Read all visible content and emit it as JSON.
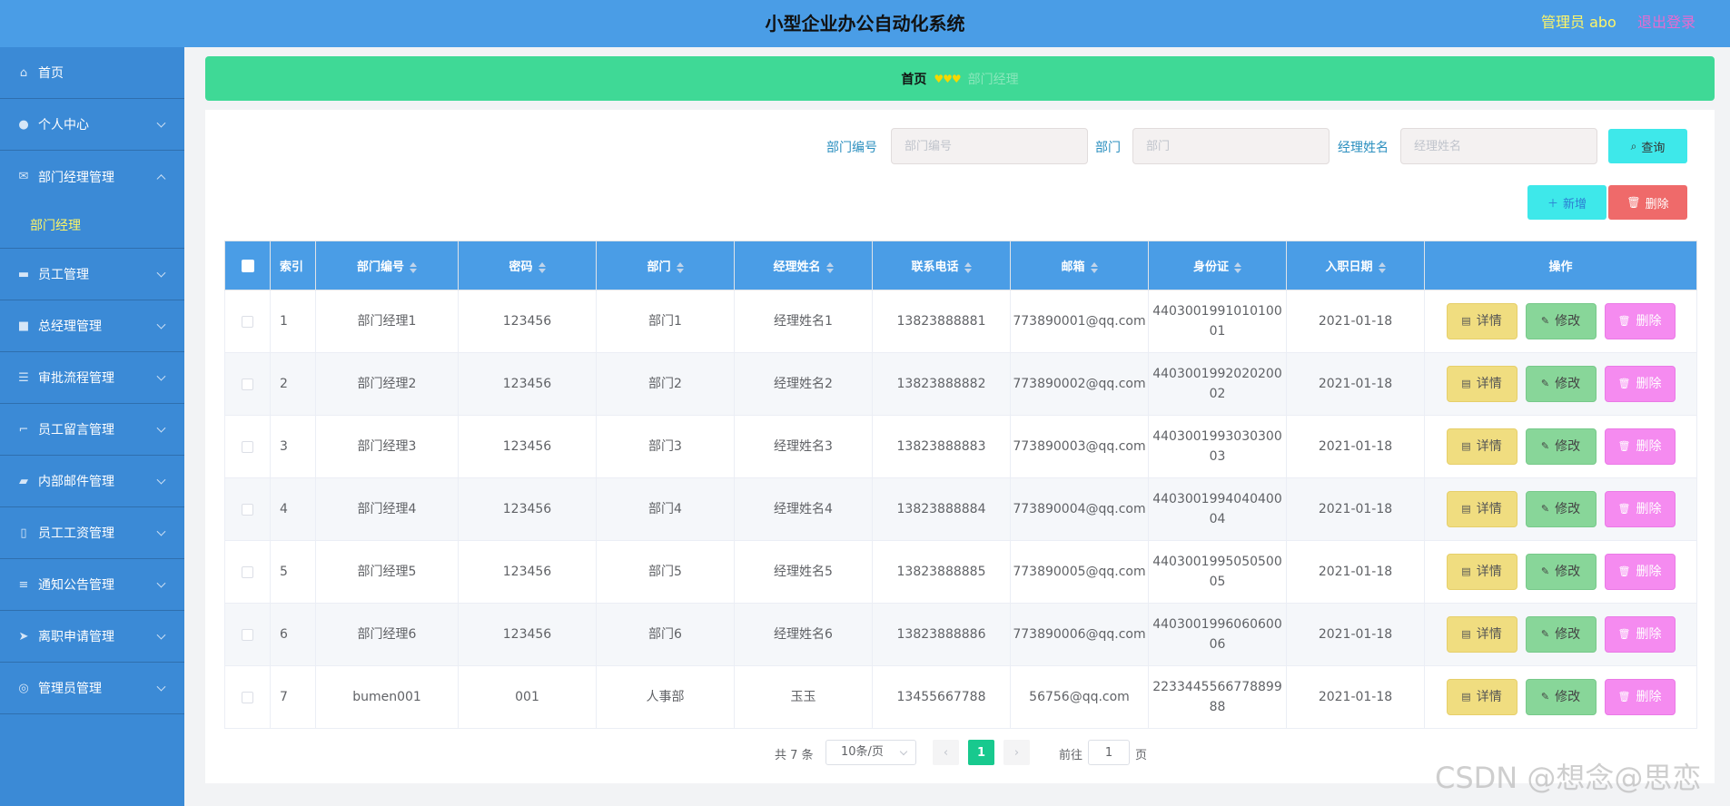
{
  "header": {
    "title": "小型企业办公自动化系统",
    "user": "管理员 abo",
    "logout": "退出登录"
  },
  "sidebar": {
    "items": [
      {
        "label": "首页",
        "icon": "home-icon"
      },
      {
        "label": "个人中心",
        "icon": "user-icon"
      },
      {
        "label": "部门经理管理",
        "icon": "mail-icon",
        "expanded": true,
        "children": [
          "部门经理"
        ]
      },
      {
        "label": "员工管理",
        "icon": "chat-icon"
      },
      {
        "label": "总经理管理",
        "icon": "video-icon"
      },
      {
        "label": "审批流程管理",
        "icon": "list-icon"
      },
      {
        "label": "员工留言管理",
        "icon": "crop-icon"
      },
      {
        "label": "内部邮件管理",
        "icon": "mailbox-icon"
      },
      {
        "label": "员工工资管理",
        "icon": "mic-icon"
      },
      {
        "label": "通知公告管理",
        "icon": "menu-icon"
      },
      {
        "label": "离职申请管理",
        "icon": "send-icon"
      },
      {
        "label": "管理员管理",
        "icon": "circle-icon"
      }
    ],
    "active_sub": "部门经理"
  },
  "breadcrumb": {
    "home": "首页",
    "current": "部门经理"
  },
  "search": {
    "fields": [
      {
        "label": "部门编号",
        "placeholder": "部门编号",
        "value": ""
      },
      {
        "label": "部门",
        "placeholder": "部门",
        "value": ""
      },
      {
        "label": "经理姓名",
        "placeholder": "经理姓名",
        "value": ""
      }
    ],
    "query_label": "查询"
  },
  "actions": {
    "add_label": "新增",
    "delete_label": "删除"
  },
  "table": {
    "columns": [
      "索引",
      "部门编号",
      "密码",
      "部门",
      "经理姓名",
      "联系电话",
      "邮箱",
      "身份证",
      "入职日期",
      "操作"
    ],
    "rows": [
      {
        "index": "1",
        "code": "部门经理1",
        "password": "123456",
        "dept": "部门1",
        "name": "经理姓名1",
        "phone": "13823888881",
        "email": "773890001@qq.com",
        "idcard": "440300199101010001",
        "date": "2021-01-18"
      },
      {
        "index": "2",
        "code": "部门经理2",
        "password": "123456",
        "dept": "部门2",
        "name": "经理姓名2",
        "phone": "13823888882",
        "email": "773890002@qq.com",
        "idcard": "440300199202020002",
        "date": "2021-01-18"
      },
      {
        "index": "3",
        "code": "部门经理3",
        "password": "123456",
        "dept": "部门3",
        "name": "经理姓名3",
        "phone": "13823888883",
        "email": "773890003@qq.com",
        "idcard": "440300199303030003",
        "date": "2021-01-18"
      },
      {
        "index": "4",
        "code": "部门经理4",
        "password": "123456",
        "dept": "部门4",
        "name": "经理姓名4",
        "phone": "13823888884",
        "email": "773890004@qq.com",
        "idcard": "440300199404040004",
        "date": "2021-01-18"
      },
      {
        "index": "5",
        "code": "部门经理5",
        "password": "123456",
        "dept": "部门5",
        "name": "经理姓名5",
        "phone": "13823888885",
        "email": "773890005@qq.com",
        "idcard": "440300199505050005",
        "date": "2021-01-18"
      },
      {
        "index": "6",
        "code": "部门经理6",
        "password": "123456",
        "dept": "部门6",
        "name": "经理姓名6",
        "phone": "13823888886",
        "email": "773890006@qq.com",
        "idcard": "440300199606060006",
        "date": "2021-01-18"
      },
      {
        "index": "7",
        "code": "bumen001",
        "password": "001",
        "dept": "人事部",
        "name": "玉玉",
        "phone": "13455667788",
        "email": "56756@qq.com",
        "idcard": "223344556677889988",
        "date": "2021-01-18"
      }
    ],
    "ops": {
      "detail": "详情",
      "edit": "修改",
      "delete": "删除"
    }
  },
  "pagination": {
    "total": "共 7 条",
    "page_size": "10条/页",
    "current_page": "1",
    "goto_prefix": "前往",
    "goto_value": "1",
    "goto_suffix": "页"
  },
  "watermark": "CSDN @想念@思恋",
  "colors": {
    "header": "#4a9de6",
    "sidebar": "#3b8ad6",
    "breadcrumb": "#3fd996",
    "table_header": "#4a9de6",
    "query_button": "#3ee8ea",
    "delete_button": "#ef6a6a",
    "detail_button": "#f0dd80",
    "edit_button": "#88d699",
    "row_delete_button": "#f58bf0",
    "active_page": "#18c98e"
  }
}
